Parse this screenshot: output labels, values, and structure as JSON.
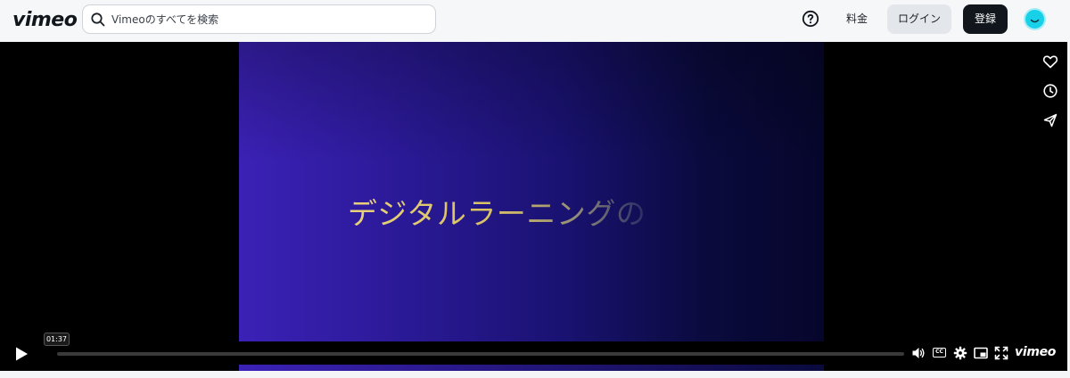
{
  "header": {
    "logo": "vimeo",
    "search_placeholder": "Vimeoのすべてを検索",
    "pricing_label": "料金",
    "login_label": "ログイン",
    "signup_label": "登録"
  },
  "player": {
    "slide_text": "デジタルラーニングの",
    "timestamp": "01:37",
    "progress": 0.0,
    "cc_label": "CC",
    "brand": "vimeo",
    "icons": [
      "heart-icon",
      "clock-icon",
      "send-icon",
      "play-icon",
      "volume-icon",
      "cc-icon",
      "settings-icon",
      "pip-icon",
      "fullscreen-icon"
    ]
  }
}
